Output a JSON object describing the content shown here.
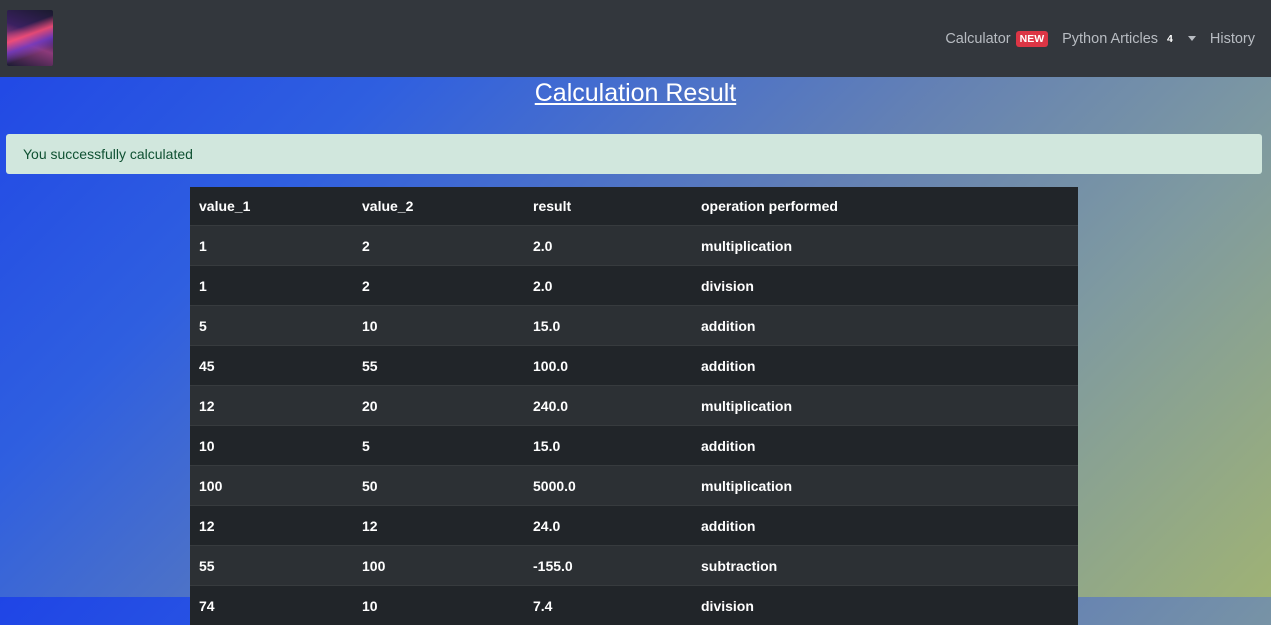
{
  "navbar": {
    "items": [
      {
        "label": "Calculator",
        "badge": "NEW"
      },
      {
        "label": "Python Articles",
        "badge": "4"
      },
      {
        "label": "History"
      }
    ]
  },
  "page": {
    "title": "Calculation Result",
    "alert": "You successfully calculated"
  },
  "table": {
    "headers": [
      "value_1",
      "value_2",
      "result",
      "operation performed"
    ],
    "rows": [
      [
        "1",
        "2",
        "2.0",
        "multiplication"
      ],
      [
        "1",
        "2",
        "2.0",
        "division"
      ],
      [
        "5",
        "10",
        "15.0",
        "addition"
      ],
      [
        "45",
        "55",
        "100.0",
        "addition"
      ],
      [
        "12",
        "20",
        "240.0",
        "multiplication"
      ],
      [
        "10",
        "5",
        "15.0",
        "addition"
      ],
      [
        "100",
        "50",
        "5000.0",
        "multiplication"
      ],
      [
        "12",
        "12",
        "24.0",
        "addition"
      ],
      [
        "55",
        "100",
        "-155.0",
        "subtraction"
      ],
      [
        "74",
        "10",
        "7.4",
        "division"
      ]
    ]
  }
}
